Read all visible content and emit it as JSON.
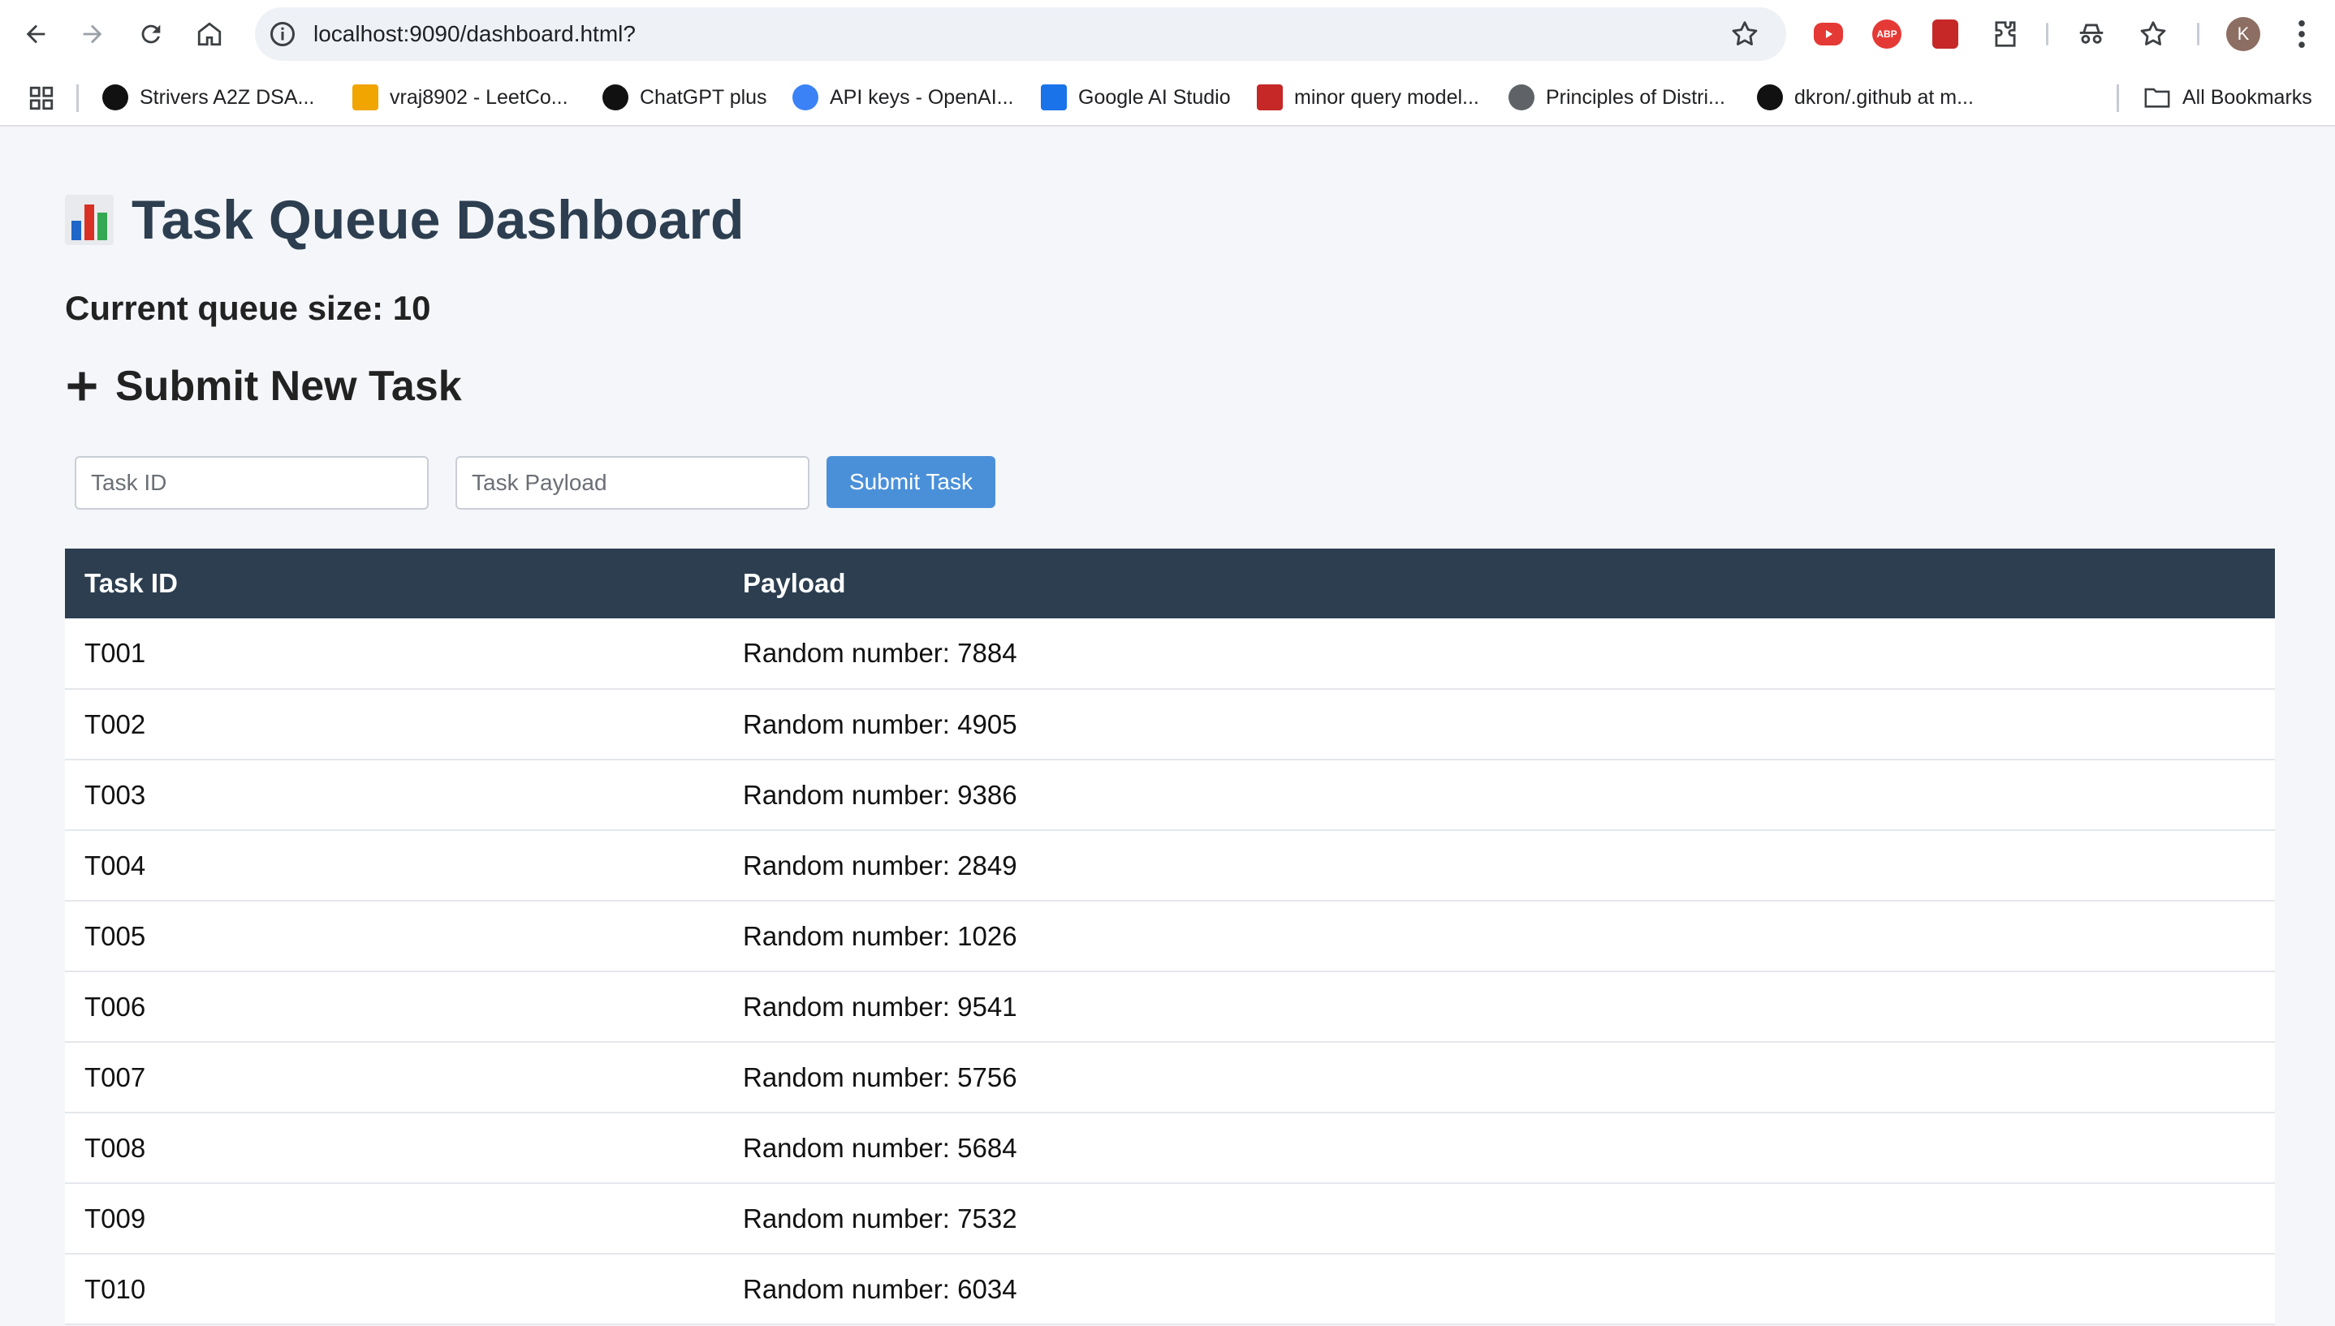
{
  "browser": {
    "url": "localhost:9090/dashboard.html?",
    "avatar_letter": "K",
    "extensions": [
      "youtube-ext",
      "adblock-ext",
      "pdf-ext",
      "puzzle-icon"
    ],
    "abp_label": "ABP"
  },
  "bookmarks": [
    {
      "label": "Strivers A2Z DSA...",
      "icon": "tuf-icon",
      "color": "#111111"
    },
    {
      "label": "vraj8902 - LeetCo...",
      "icon": "leetcode-icon",
      "color": "#f0a500"
    },
    {
      "label": "ChatGPT plus",
      "icon": "chatgpt-icon",
      "color": "#111111"
    },
    {
      "label": "API keys - OpenAI...",
      "icon": "openai-icon",
      "color": "#3b82f6"
    },
    {
      "label": "Google AI Studio",
      "icon": "ai-studio-icon",
      "color": "#1a73e8"
    },
    {
      "label": "minor query model...",
      "icon": "pdf-icon",
      "color": "#c62828"
    },
    {
      "label": "Principles of Distri...",
      "icon": "globe-icon",
      "color": "#5f6368"
    },
    {
      "label": "dkron/.github at m...",
      "icon": "github-icon",
      "color": "#111111"
    }
  ],
  "all_bookmarks_label": "All Bookmarks",
  "page": {
    "title": "Task Queue Dashboard",
    "queue_size": "Current queue size: 10",
    "submit_heading": "Submit New Task",
    "task_id_placeholder": "Task ID",
    "task_payload_placeholder": "Task Payload",
    "submit_label": "Submit Task"
  },
  "table": {
    "headers": [
      "Task ID",
      "Payload"
    ],
    "rows": [
      [
        "T001",
        "Random number: 7884"
      ],
      [
        "T002",
        "Random number: 4905"
      ],
      [
        "T003",
        "Random number: 9386"
      ],
      [
        "T004",
        "Random number: 2849"
      ],
      [
        "T005",
        "Random number: 1026"
      ],
      [
        "T006",
        "Random number: 9541"
      ],
      [
        "T007",
        "Random number: 5756"
      ],
      [
        "T008",
        "Random number: 5684"
      ],
      [
        "T009",
        "Random number: 7532"
      ],
      [
        "T010",
        "Random number: 6034"
      ]
    ]
  },
  "colors": {
    "header_bg": "#2c3e50",
    "button_bg": "#4a90d9",
    "page_bg": "#f4f6f9"
  }
}
